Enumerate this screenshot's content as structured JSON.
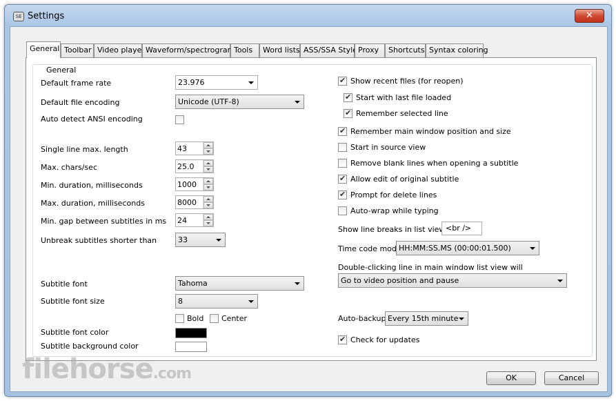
{
  "window": {
    "title": "Settings",
    "close_glyph": "✕",
    "icon_text": "SE"
  },
  "tabs": [
    "General",
    "Toolbar",
    "Video player",
    "Waveform/spectrogram",
    "Tools",
    "Word lists",
    "ASS/SSA Style",
    "Proxy",
    "Shortcuts",
    "Syntax coloring"
  ],
  "active_tab": "General",
  "group_title": "General",
  "left": {
    "default_frame_rate": {
      "label": "Default frame rate",
      "value": "23.976"
    },
    "default_file_encoding": {
      "label": "Default file encoding",
      "value": "Unicode (UTF-8)"
    },
    "auto_detect_ansi": {
      "label": "Auto detect ANSI encoding",
      "checked": false
    },
    "single_line_max": {
      "label": "Single line max. length",
      "value": "43"
    },
    "max_chars_sec": {
      "label": "Max. chars/sec",
      "value": "25.0"
    },
    "min_duration": {
      "label": "Min. duration, milliseconds",
      "value": "1000"
    },
    "max_duration": {
      "label": "Max. duration, milliseconds",
      "value": "8000"
    },
    "min_gap": {
      "label": "Min. gap between subtitles in ms",
      "value": "24"
    },
    "unbreak": {
      "label": "Unbreak subtitles shorter than",
      "value": "33"
    },
    "subtitle_font": {
      "label": "Subtitle font",
      "value": "Tahoma"
    },
    "subtitle_font_size": {
      "label": "Subtitle font size",
      "value": "8"
    },
    "bold": {
      "label": "Bold",
      "checked": false
    },
    "center": {
      "label": "Center",
      "checked": false
    },
    "font_color": {
      "label": "Subtitle font color",
      "color": "#000000"
    },
    "bg_color": {
      "label": "Subtitle background color",
      "color": "#ffffff"
    }
  },
  "right": {
    "show_recent": {
      "label": "Show recent files (for reopen)",
      "checked": true
    },
    "start_last": {
      "label": "Start with last file loaded",
      "checked": true
    },
    "remember_line": {
      "label": "Remember selected line",
      "checked": true
    },
    "remember_window": {
      "label": "Remember main window position and size",
      "checked": true
    },
    "start_source": {
      "label": "Start in source view",
      "checked": false
    },
    "remove_blank": {
      "label": "Remove blank lines when opening a subtitle",
      "checked": false
    },
    "allow_edit": {
      "label": "Allow edit of original subtitle",
      "checked": true
    },
    "prompt_delete": {
      "label": "Prompt for delete lines",
      "checked": true
    },
    "auto_wrap": {
      "label": "Auto-wrap while typing",
      "checked": false
    },
    "line_breaks": {
      "label": "Show line breaks in list view as",
      "value": "<br />"
    },
    "time_code_mode": {
      "label": "Time code mode",
      "value": "HH:MM:SS.MS (00:00:01.500)"
    },
    "double_click": {
      "label": "Double-clicking line in main window list view will",
      "value": "Go to video position and pause"
    },
    "auto_backup": {
      "label": "Auto-backup",
      "value": "Every 15th minute"
    },
    "check_updates": {
      "label": "Check for updates",
      "checked": true
    }
  },
  "buttons": {
    "ok": "OK",
    "cancel": "Cancel"
  },
  "watermark": {
    "main": "filehorse",
    "suffix": ".com"
  }
}
